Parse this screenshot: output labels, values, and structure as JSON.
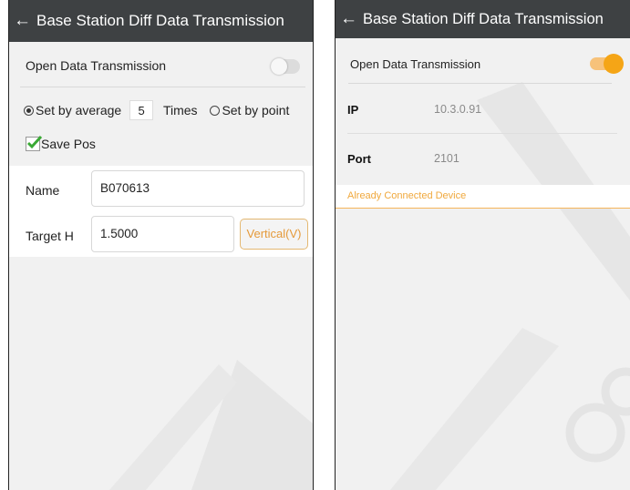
{
  "left_screen": {
    "title": "Base Station Diff Data Transmission",
    "open_data_transmission_label": "Open Data Transmission",
    "open_data_transmission_on": false,
    "set_by_average_label": "Set by average",
    "average_times_value": "5",
    "times_label": "Times",
    "set_by_point_label": "Set by point",
    "save_pos_label": "Save Pos",
    "save_pos_checked": true,
    "name_label": "Name",
    "name_value": "B070613",
    "target_h_label": "Target H",
    "target_h_value": "1.5000",
    "vertical_button_label": "Vertical(V)"
  },
  "right_screen": {
    "title": "Base Station Diff Data Transmission",
    "open_data_transmission_label": "Open Data Transmission",
    "open_data_transmission_on": true,
    "ip_label": "IP",
    "ip_value": "10.3.0.91",
    "port_label": "Port",
    "port_value": "2101",
    "already_connected_label": "Already Connected Device"
  },
  "colors": {
    "titlebar_bg": "#3e4143",
    "accent_orange": "#f5a516",
    "checkmark_green": "#3aa935"
  }
}
